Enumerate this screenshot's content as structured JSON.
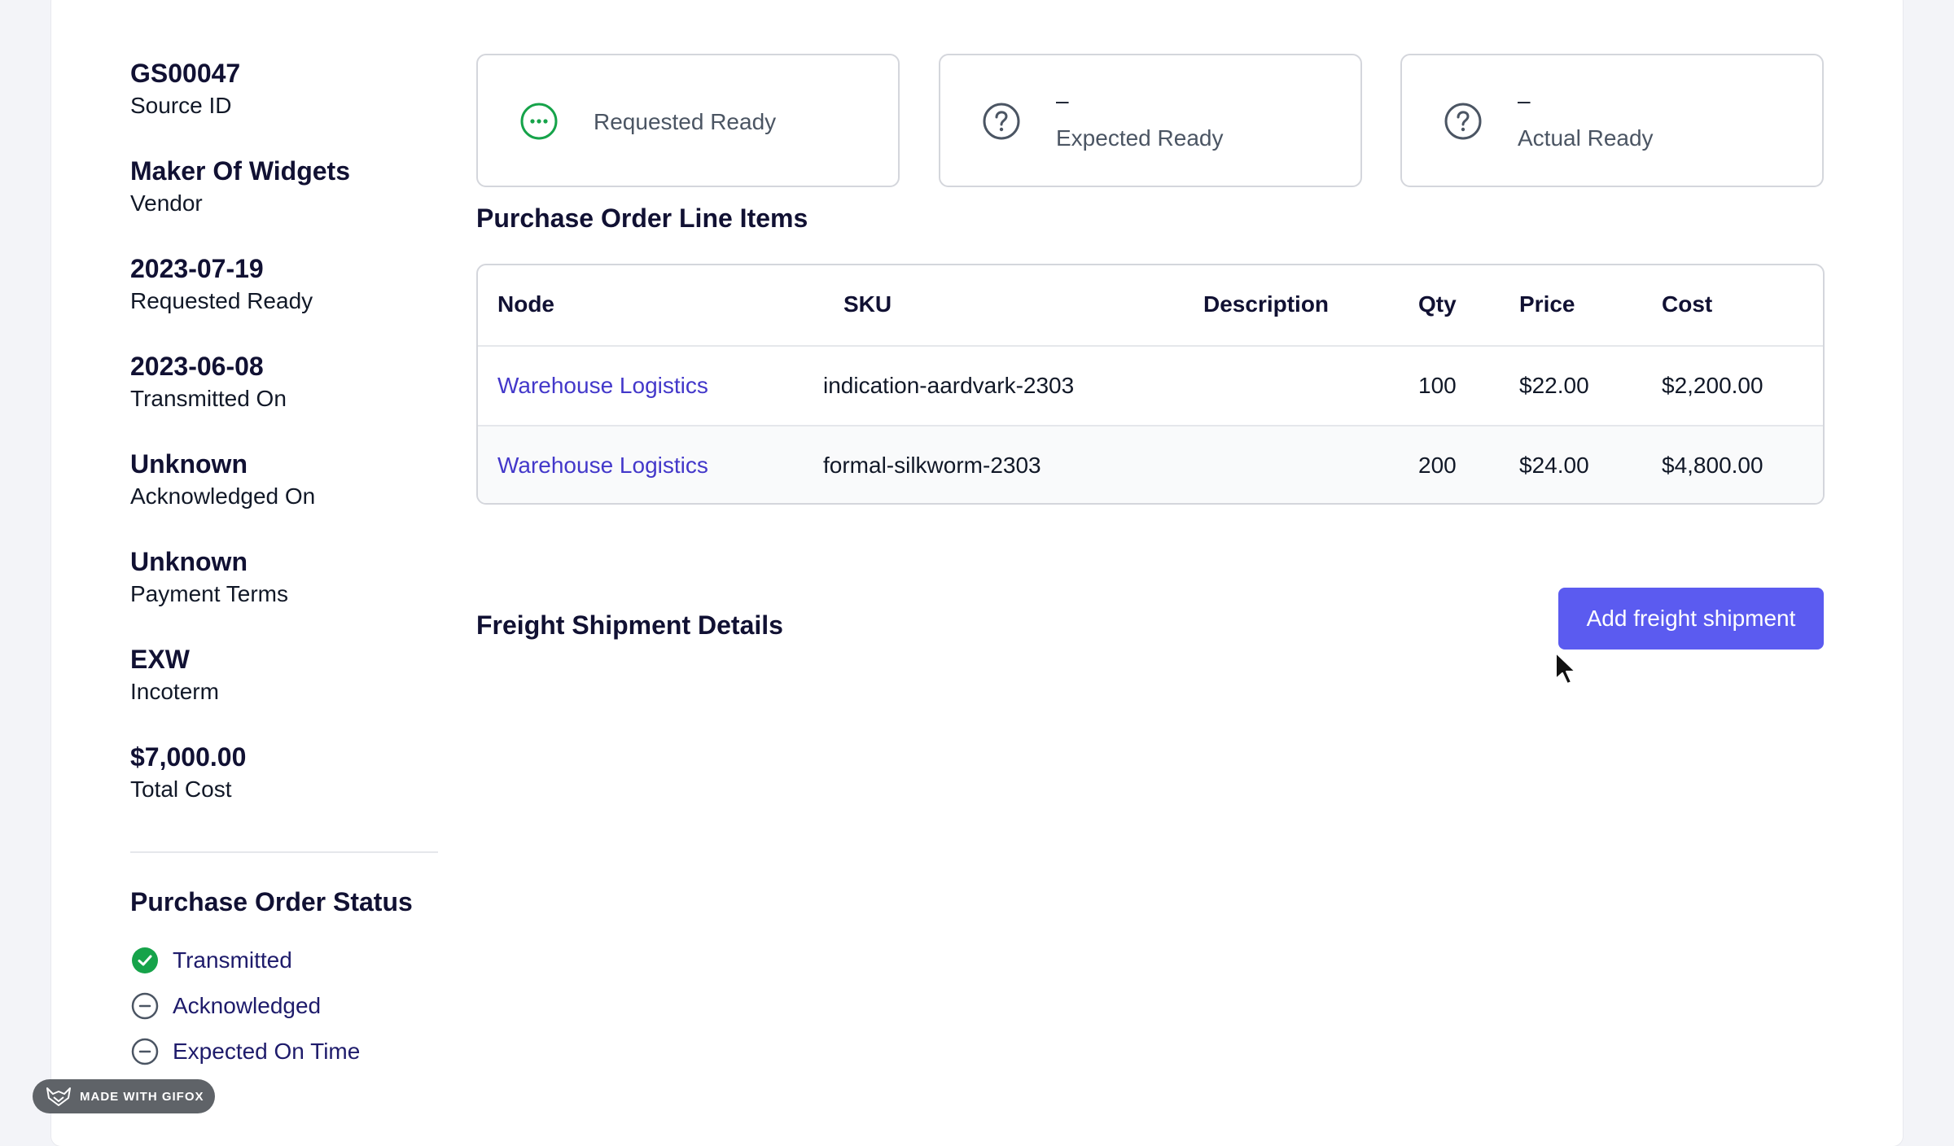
{
  "details": [
    {
      "value": "GS00047",
      "label": "Source ID"
    },
    {
      "value": "Maker Of Widgets",
      "label": "Vendor"
    },
    {
      "value": "2023-07-19",
      "label": "Requested Ready"
    },
    {
      "value": "2023-06-08",
      "label": "Transmitted On"
    },
    {
      "value": "Unknown",
      "label": "Acknowledged On"
    },
    {
      "value": "Unknown",
      "label": "Payment Terms"
    },
    {
      "value": "EXW",
      "label": "Incoterm"
    },
    {
      "value": "$7,000.00",
      "label": "Total Cost"
    }
  ],
  "status": {
    "title": "Purchase Order Status",
    "items": [
      {
        "label": "Transmitted",
        "icon": "check-circle-icon"
      },
      {
        "label": "Acknowledged",
        "icon": "minus-circle-icon"
      },
      {
        "label": "Expected On Time",
        "icon": "minus-circle-icon"
      }
    ]
  },
  "milestones": [
    {
      "value": "",
      "label": "Requested Ready",
      "icon": "ellipsis-circle-icon"
    },
    {
      "value": "–",
      "label": "Expected Ready",
      "icon": "question-circle-icon"
    },
    {
      "value": "–",
      "label": "Actual Ready",
      "icon": "question-circle-icon"
    }
  ],
  "line_items": {
    "title": "Purchase Order Line Items",
    "columns": [
      "Node",
      "SKU",
      "Description",
      "Qty",
      "Price",
      "Cost"
    ],
    "rows": [
      {
        "node": "Warehouse Logistics",
        "sku": "indication-aardvark-2303",
        "description": "",
        "qty": "100",
        "price": "$22.00",
        "cost": "$2,200.00"
      },
      {
        "node": "Warehouse Logistics",
        "sku": "formal-silkworm-2303",
        "description": "",
        "qty": "200",
        "price": "$24.00",
        "cost": "$4,800.00"
      }
    ]
  },
  "freight": {
    "title": "Freight Shipment Details",
    "add_button": "Add freight shipment"
  },
  "badge": {
    "text": "MADE WITH GIFOX"
  },
  "colors": {
    "accent": "#5b5bf0",
    "link": "#4338ca",
    "success": "#16a34a",
    "heading": "#111133"
  }
}
